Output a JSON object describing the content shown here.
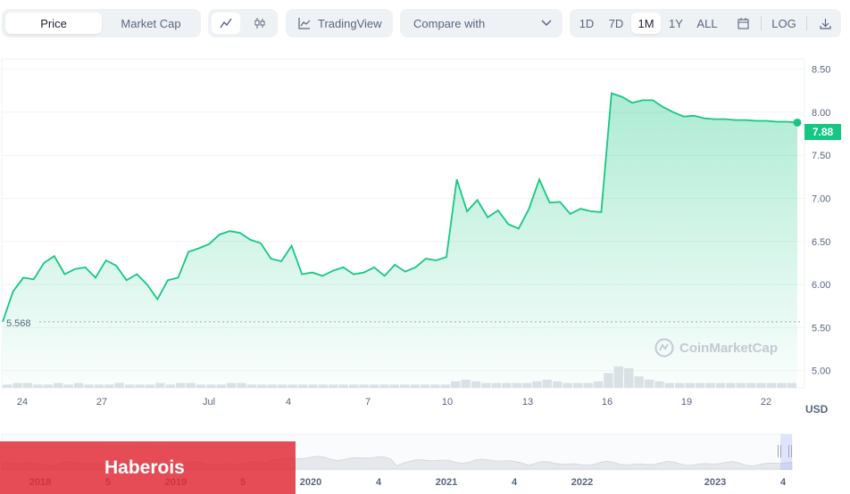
{
  "toolbar": {
    "price_tab": "Price",
    "market_cap_tab": "Market Cap",
    "line_icon": "line-chart-icon",
    "candle_icon": "candlestick-icon",
    "tradingview_label": "TradingView",
    "compare_label": "Compare with",
    "ranges": [
      "1D",
      "7D",
      "1M",
      "1Y",
      "ALL"
    ],
    "active_range": "1M",
    "calendar_icon": "calendar-icon",
    "log_label": "LOG",
    "download_icon": "download-icon"
  },
  "chart": {
    "current_price_label": "7.88",
    "min_label": "5.568",
    "currency": "USD",
    "watermark": "CoinMarketCap",
    "accent_color": "#16c784"
  },
  "banner": {
    "text": "Haberois"
  },
  "chart_data": {
    "type": "area",
    "ylim": [
      4.8,
      8.62
    ],
    "yticks": [
      "8.50",
      "8.00",
      "7.50",
      "7.00",
      "6.50",
      "6.00",
      "5.50",
      "5.00"
    ],
    "xticks": [
      "24",
      "27",
      "Jul",
      "4",
      "7",
      "10",
      "13",
      "16",
      "19",
      "22"
    ],
    "series": [
      {
        "x": [
          0,
          0.3,
          0.6,
          0.9,
          1.2,
          1.5,
          1.8,
          2.1,
          2.4,
          2.7,
          3.0,
          3.3,
          3.6,
          3.9,
          4.2,
          4.5,
          4.8,
          5.1,
          5.4,
          5.7,
          6.0,
          6.3,
          6.6,
          6.9,
          7.2,
          7.5,
          7.8,
          8.1,
          8.4,
          8.7,
          9.0,
          9.3,
          9.6,
          9.9,
          10.2,
          10.5,
          10.8,
          11.1,
          11.4,
          11.7,
          12.0,
          12.3,
          12.6,
          12.9,
          13.2,
          13.5,
          13.8,
          14.1,
          14.4,
          14.7,
          15.0,
          15.3,
          15.6,
          15.9,
          16.2,
          16.5,
          16.8,
          17.1,
          17.4,
          17.7,
          18.0,
          18.3,
          18.6,
          18.9,
          19.2,
          19.5,
          19.8,
          20.1,
          20.4,
          20.7,
          21.0,
          21.3,
          21.6,
          21.9,
          22.2,
          22.5,
          22.8,
          23.1
        ],
        "values": [
          5.568,
          5.92,
          6.08,
          6.06,
          6.25,
          6.33,
          6.12,
          6.18,
          6.2,
          6.08,
          6.28,
          6.22,
          6.05,
          6.12,
          6.0,
          5.83,
          6.05,
          6.08,
          6.38,
          6.42,
          6.47,
          6.58,
          6.62,
          6.6,
          6.52,
          6.48,
          6.3,
          6.27,
          6.45,
          6.12,
          6.14,
          6.1,
          6.16,
          6.2,
          6.12,
          6.14,
          6.2,
          6.1,
          6.23,
          6.15,
          6.2,
          6.3,
          6.28,
          6.32,
          7.22,
          6.85,
          6.98,
          6.78,
          6.86,
          6.7,
          6.65,
          6.88,
          7.22,
          6.95,
          6.96,
          6.82,
          6.88,
          6.85,
          6.84,
          8.22,
          8.18,
          8.11,
          8.14,
          8.14,
          8.06,
          8.0,
          7.95,
          7.96,
          7.93,
          7.92,
          7.92,
          7.91,
          7.91,
          7.9,
          7.9,
          7.89,
          7.89,
          7.88
        ]
      }
    ],
    "volume": [
      2,
      3,
      3,
      2,
      2,
      3,
      2,
      3,
      2,
      2,
      2,
      3,
      2,
      2,
      2,
      3,
      2,
      3,
      3,
      2,
      2,
      2,
      3,
      3,
      2,
      2,
      2,
      2,
      2,
      2,
      2,
      2,
      2,
      2,
      2,
      2,
      2,
      2,
      2,
      2,
      2,
      2,
      2,
      2,
      4,
      5,
      4,
      3,
      3,
      3,
      3,
      3,
      4,
      5,
      4,
      3,
      3,
      3,
      4,
      9,
      13,
      12,
      7,
      5,
      4,
      3,
      3,
      3,
      3,
      3,
      3,
      3,
      3,
      3,
      3,
      3,
      3,
      3
    ],
    "navigator_xticks": [
      "2018",
      "5",
      "2019",
      "5",
      "2020",
      "4",
      "2021",
      "4",
      "2022",
      "2023",
      "4"
    ]
  }
}
